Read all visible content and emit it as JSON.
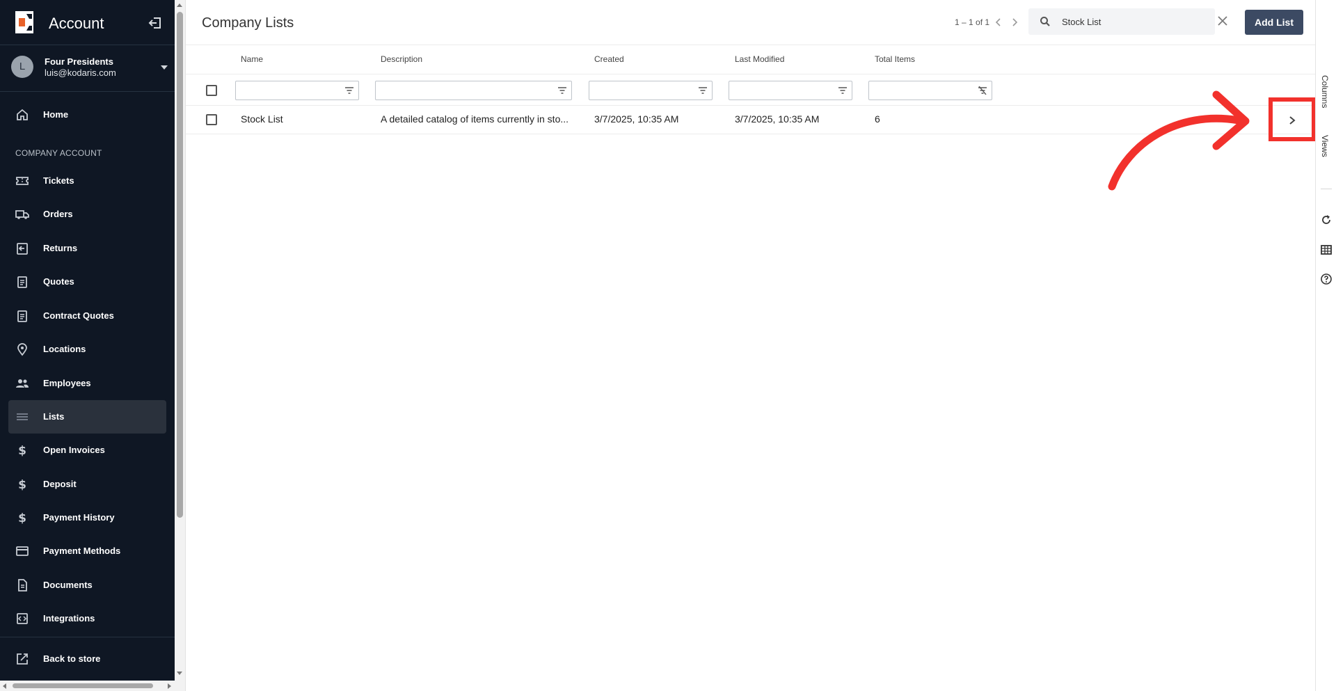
{
  "sidebar": {
    "title": "Account",
    "user": {
      "initial": "L",
      "name": "Four Presidents",
      "email": "luis@kodaris.com"
    },
    "section_label": "COMPANY ACCOUNT",
    "items": [
      {
        "label": "Home",
        "icon": "home-icon"
      },
      {
        "label": "Tickets",
        "icon": "ticket-icon"
      },
      {
        "label": "Orders",
        "icon": "truck-icon"
      },
      {
        "label": "Returns",
        "icon": "return-icon"
      },
      {
        "label": "Quotes",
        "icon": "clipboard-icon"
      },
      {
        "label": "Contract Quotes",
        "icon": "clipboard-icon"
      },
      {
        "label": "Locations",
        "icon": "location-pin-icon"
      },
      {
        "label": "Employees",
        "icon": "people-icon"
      },
      {
        "label": "Lists",
        "icon": "list-icon",
        "active": true
      },
      {
        "label": "Open Invoices",
        "icon": "dollar-icon"
      },
      {
        "label": "Deposit",
        "icon": "dollar-icon"
      },
      {
        "label": "Payment History",
        "icon": "dollar-icon"
      },
      {
        "label": "Payment Methods",
        "icon": "credit-card-icon"
      },
      {
        "label": "Documents",
        "icon": "document-icon"
      },
      {
        "label": "Integrations",
        "icon": "integration-icon"
      }
    ],
    "back_to_store": "Back to store"
  },
  "header": {
    "title": "Company Lists",
    "pagination": "1 – 1 of 1",
    "search": {
      "value": "Stock List",
      "placeholder": ""
    },
    "add_button": "Add List"
  },
  "table": {
    "columns": [
      "Name",
      "Description",
      "Created",
      "Last Modified",
      "Total Items"
    ],
    "rows": [
      {
        "name": "Stock List",
        "description": "A detailed catalog of items currently in sto...",
        "created": "3/7/2025, 10:35 AM",
        "last_modified": "3/7/2025, 10:35 AM",
        "total_items": "6"
      }
    ]
  },
  "side_panel": {
    "tabs": [
      "Columns",
      "Views"
    ],
    "icons": [
      "refresh-icon",
      "table-icon",
      "help-icon"
    ]
  },
  "colors": {
    "sidebar_bg": "#0f1724",
    "primary_button": "#3c4a63",
    "annotation": "#f2312c",
    "logo_accent": "#e8622a"
  }
}
